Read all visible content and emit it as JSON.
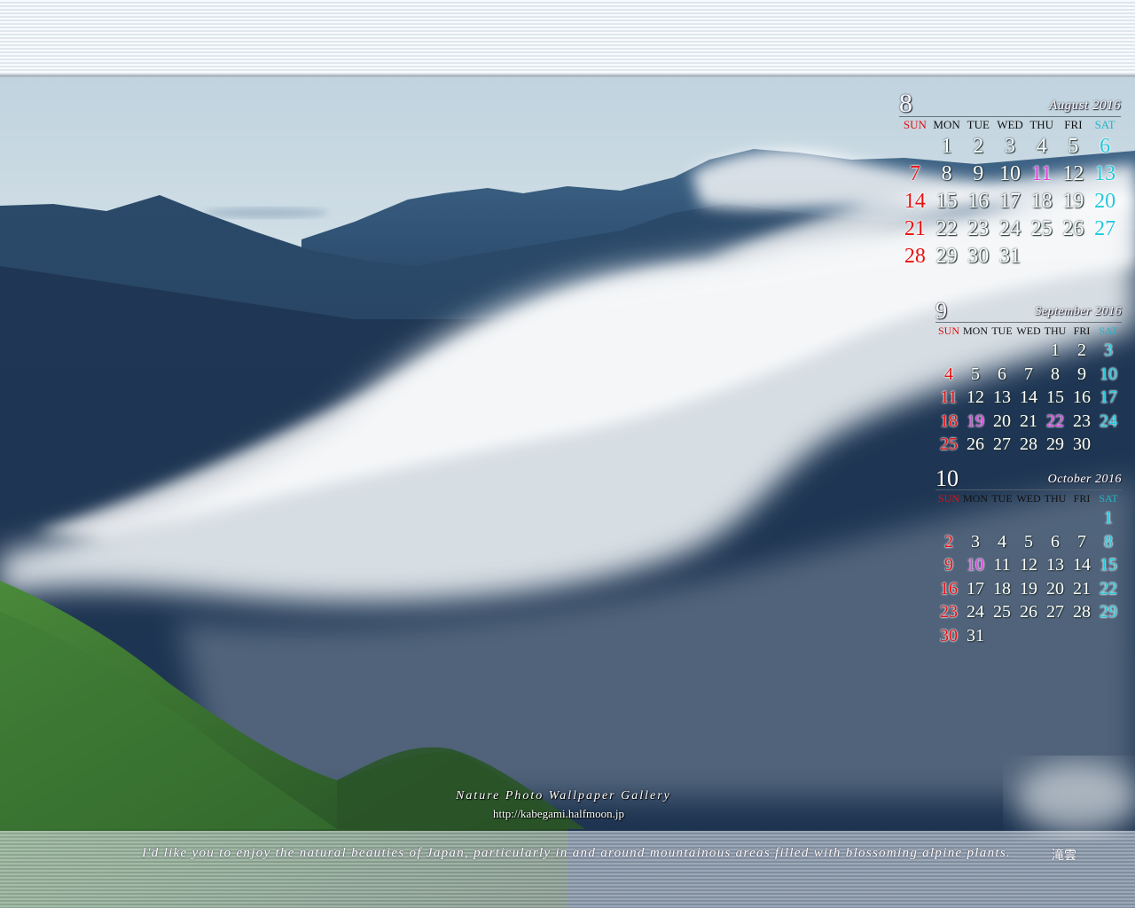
{
  "wallpaper": {
    "gallery_name": "Nature Photo Wallpaper Gallery",
    "url": "http://kabegami.halfmoon.jp",
    "tagline": "I'd like you to enjoy the natural beauties of Japan, particularly in and around mountainous areas filled with blossoming alpine plants.",
    "photo_title": "滝雲",
    "colors": {
      "sunday": "#e81010",
      "saturday": "#22c8dc",
      "holiday": "#e040e0",
      "weekday": "#ffffff"
    }
  },
  "weekdays": [
    "SUN",
    "MON",
    "TUE",
    "WED",
    "THU",
    "FRI",
    "SAT"
  ],
  "calendars": [
    {
      "month_number": "8",
      "month_name": "August 2016",
      "first_weekday": 1,
      "days_in_month": 31,
      "holidays": [
        11
      ]
    },
    {
      "month_number": "9",
      "month_name": "September 2016",
      "first_weekday": 4,
      "days_in_month": 30,
      "holidays": [
        19,
        22
      ]
    },
    {
      "month_number": "10",
      "month_name": "October 2016",
      "first_weekday": 6,
      "days_in_month": 31,
      "holidays": [
        10
      ]
    }
  ]
}
